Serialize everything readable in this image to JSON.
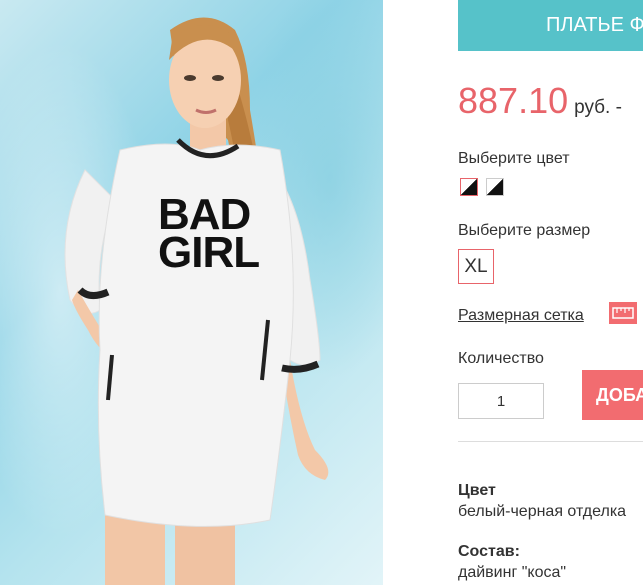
{
  "product": {
    "title": "ПЛАТЬЕ Ф",
    "price": "887.10",
    "price_unit": "руб. -",
    "print_text_line1": "BAD",
    "print_text_line2": "GIRL"
  },
  "color_selector": {
    "label": "Выберите цвет",
    "swatches": [
      "white-black",
      "grey-black"
    ]
  },
  "size_selector": {
    "label": "Выберите размер",
    "options": [
      "XL"
    ]
  },
  "size_chart_link": "Размерная сетка",
  "quantity": {
    "label": "Количество",
    "value": "1"
  },
  "add_button_label": "ДОБА",
  "attributes": [
    {
      "key": "Цвет",
      "value": "белый-черная отделка"
    },
    {
      "key": "Состав:",
      "value": "дайвинг \"коса\""
    }
  ],
  "colors": {
    "accent_teal": "#56c2c9",
    "accent_red": "#f26c70",
    "price_red": "#e8646a"
  }
}
